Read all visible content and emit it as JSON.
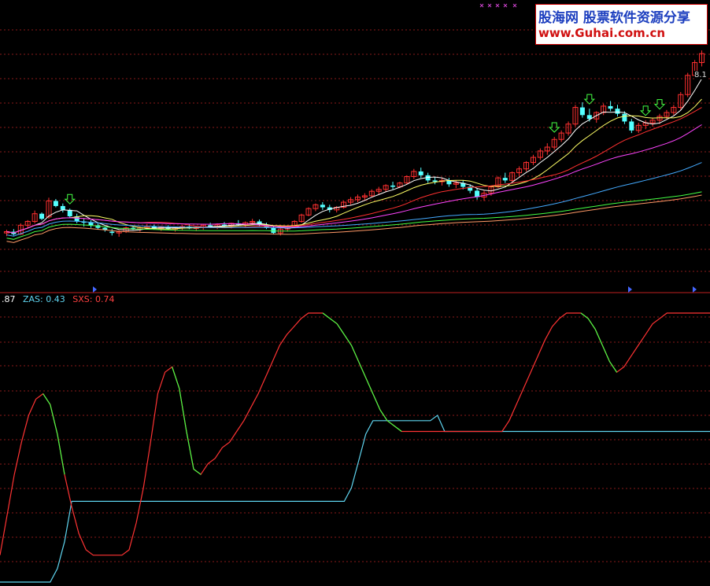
{
  "watermark": {
    "line1": "股海网 股票软件资源分享",
    "line2": "www.Guhai.com.cn"
  },
  "price_tag": "8.1",
  "legend": [
    {
      "text": ".87",
      "color": "#ffffff"
    },
    {
      "text": "ZAS: 0.43",
      "color": "#5fd5f0"
    },
    {
      "text": "SXS: 0.74",
      "color": "#ff4040"
    }
  ],
  "colors": {
    "up": "#ff3030",
    "down": "#54ffff",
    "grid": "#8a1a1a",
    "ma5": "#ffffff",
    "ma10": "#ffff66",
    "ma20": "#ff3030",
    "ma30": "#ff44ff",
    "ma60": "#44aaff",
    "ma120": "#44ff44",
    "ma250": "#ff9966",
    "zas": "#5fd5f0",
    "sxs": "#ff3333",
    "osc_green": "#44ff44"
  },
  "chart_data": [
    {
      "type": "candlestick",
      "title": "",
      "ylim": [
        4.8,
        8.3
      ],
      "candles": [
        [
          5.4,
          5.45,
          5.35,
          5.42
        ],
        [
          5.42,
          5.46,
          5.36,
          5.38
        ],
        [
          5.38,
          5.55,
          5.37,
          5.52
        ],
        [
          5.52,
          5.6,
          5.48,
          5.58
        ],
        [
          5.58,
          5.75,
          5.55,
          5.7
        ],
        [
          5.7,
          5.72,
          5.6,
          5.62
        ],
        [
          5.65,
          5.95,
          5.62,
          5.9
        ],
        [
          5.9,
          5.93,
          5.8,
          5.82
        ],
        [
          5.82,
          5.86,
          5.72,
          5.76
        ],
        [
          5.76,
          5.78,
          5.64,
          5.66
        ],
        [
          5.66,
          5.7,
          5.55,
          5.58
        ],
        [
          5.58,
          5.62,
          5.5,
          5.56
        ],
        [
          5.56,
          5.6,
          5.48,
          5.52
        ],
        [
          5.52,
          5.55,
          5.45,
          5.48
        ],
        [
          5.48,
          5.5,
          5.42,
          5.45
        ],
        [
          5.42,
          5.46,
          5.36,
          5.4
        ],
        [
          5.4,
          5.44,
          5.34,
          5.42
        ],
        [
          5.42,
          5.5,
          5.4,
          5.48
        ],
        [
          5.48,
          5.52,
          5.44,
          5.46
        ],
        [
          5.46,
          5.5,
          5.42,
          5.48
        ],
        [
          5.48,
          5.54,
          5.46,
          5.5
        ],
        [
          5.5,
          5.53,
          5.45,
          5.47
        ],
        [
          5.47,
          5.51,
          5.43,
          5.49
        ],
        [
          5.49,
          5.52,
          5.45,
          5.46
        ],
        [
          5.46,
          5.5,
          5.42,
          5.48
        ],
        [
          5.48,
          5.52,
          5.44,
          5.5
        ],
        [
          5.5,
          5.54,
          5.46,
          5.47
        ],
        [
          5.47,
          5.51,
          5.43,
          5.49
        ],
        [
          5.49,
          5.53,
          5.45,
          5.52
        ],
        [
          5.52,
          5.56,
          5.48,
          5.5
        ],
        [
          5.5,
          5.55,
          5.46,
          5.53
        ],
        [
          5.53,
          5.57,
          5.49,
          5.51
        ],
        [
          5.51,
          5.56,
          5.47,
          5.55
        ],
        [
          5.55,
          5.6,
          5.51,
          5.53
        ],
        [
          5.53,
          5.58,
          5.49,
          5.56
        ],
        [
          5.56,
          5.62,
          5.52,
          5.58
        ],
        [
          5.58,
          5.61,
          5.5,
          5.52
        ],
        [
          5.52,
          5.56,
          5.46,
          5.48
        ],
        [
          5.48,
          5.5,
          5.38,
          5.4
        ],
        [
          5.4,
          5.48,
          5.36,
          5.46
        ],
        [
          5.46,
          5.52,
          5.42,
          5.5
        ],
        [
          5.5,
          5.6,
          5.48,
          5.58
        ],
        [
          5.58,
          5.7,
          5.56,
          5.68
        ],
        [
          5.68,
          5.8,
          5.66,
          5.78
        ],
        [
          5.78,
          5.86,
          5.74,
          5.84
        ],
        [
          5.84,
          5.88,
          5.76,
          5.8
        ],
        [
          5.8,
          5.84,
          5.72,
          5.76
        ],
        [
          5.76,
          5.82,
          5.72,
          5.8
        ],
        [
          5.8,
          5.9,
          5.78,
          5.88
        ],
        [
          5.88,
          5.96,
          5.84,
          5.92
        ],
        [
          5.92,
          6.0,
          5.88,
          5.96
        ],
        [
          5.96,
          6.02,
          5.9,
          5.98
        ],
        [
          5.98,
          6.08,
          5.96,
          6.05
        ],
        [
          6.05,
          6.12,
          6.0,
          6.08
        ],
        [
          6.08,
          6.16,
          6.04,
          6.14
        ],
        [
          6.14,
          6.2,
          6.08,
          6.12
        ],
        [
          6.12,
          6.2,
          6.1,
          6.18
        ],
        [
          6.18,
          6.3,
          6.16,
          6.28
        ],
        [
          6.28,
          6.4,
          6.24,
          6.36
        ],
        [
          6.36,
          6.42,
          6.26,
          6.3
        ],
        [
          6.3,
          6.34,
          6.18,
          6.22
        ],
        [
          6.22,
          6.28,
          6.16,
          6.2
        ],
        [
          6.2,
          6.26,
          6.14,
          6.22
        ],
        [
          6.22,
          6.26,
          6.12,
          6.16
        ],
        [
          6.16,
          6.22,
          6.1,
          6.18
        ],
        [
          6.18,
          6.22,
          6.08,
          6.12
        ],
        [
          6.12,
          6.16,
          6.02,
          6.06
        ],
        [
          6.06,
          6.1,
          5.92,
          5.96
        ],
        [
          5.96,
          6.06,
          5.9,
          6.02
        ],
        [
          6.02,
          6.14,
          5.98,
          6.12
        ],
        [
          6.12,
          6.28,
          6.1,
          6.26
        ],
        [
          6.26,
          6.34,
          6.18,
          6.22
        ],
        [
          6.22,
          6.36,
          6.2,
          6.34
        ],
        [
          6.34,
          6.44,
          6.28,
          6.4
        ],
        [
          6.4,
          6.52,
          6.36,
          6.5
        ],
        [
          6.5,
          6.62,
          6.46,
          6.58
        ],
        [
          6.58,
          6.72,
          6.54,
          6.68
        ],
        [
          6.68,
          6.8,
          6.62,
          6.74
        ],
        [
          6.74,
          6.9,
          6.7,
          6.86
        ],
        [
          6.86,
          7.0,
          6.82,
          6.96
        ],
        [
          6.96,
          7.14,
          6.92,
          7.1
        ],
        [
          7.1,
          7.4,
          7.06,
          7.36
        ],
        [
          7.36,
          7.44,
          7.2,
          7.24
        ],
        [
          7.24,
          7.34,
          7.14,
          7.18
        ],
        [
          7.18,
          7.3,
          7.12,
          7.28
        ],
        [
          7.28,
          7.42,
          7.24,
          7.38
        ],
        [
          7.38,
          7.46,
          7.3,
          7.34
        ],
        [
          7.34,
          7.4,
          7.22,
          7.26
        ],
        [
          7.26,
          7.3,
          7.1,
          7.14
        ],
        [
          7.14,
          7.18,
          6.96,
          7.0
        ],
        [
          7.0,
          7.12,
          6.96,
          7.08
        ],
        [
          7.08,
          7.16,
          7.02,
          7.12
        ],
        [
          7.12,
          7.2,
          7.06,
          7.16
        ],
        [
          7.16,
          7.26,
          7.1,
          7.22
        ],
        [
          7.22,
          7.32,
          7.18,
          7.28
        ],
        [
          7.28,
          7.4,
          7.24,
          7.36
        ],
        [
          7.36,
          7.6,
          7.32,
          7.56
        ],
        [
          7.56,
          7.9,
          7.52,
          7.86
        ],
        [
          7.86,
          8.1,
          7.8,
          8.06
        ],
        [
          8.06,
          8.25,
          8.0,
          8.2
        ]
      ],
      "ma_periods": [
        5,
        10,
        20,
        30,
        60,
        120,
        250
      ],
      "arrows": [
        9,
        78,
        83,
        91,
        93
      ]
    },
    {
      "type": "line",
      "title": "",
      "ylim": [
        0,
        1
      ],
      "series": [
        {
          "name": "ZAS",
          "color": "#5fd5f0",
          "values": [
            0.0,
            0.0,
            0.0,
            0.0,
            0.0,
            0.0,
            0.0,
            0.0,
            0.05,
            0.15,
            0.3,
            0.3,
            0.3,
            0.3,
            0.3,
            0.3,
            0.3,
            0.3,
            0.3,
            0.3,
            0.3,
            0.3,
            0.3,
            0.3,
            0.3,
            0.3,
            0.3,
            0.3,
            0.3,
            0.3,
            0.3,
            0.3,
            0.3,
            0.3,
            0.3,
            0.3,
            0.3,
            0.3,
            0.3,
            0.3,
            0.3,
            0.3,
            0.3,
            0.3,
            0.3,
            0.3,
            0.3,
            0.3,
            0.3,
            0.35,
            0.45,
            0.55,
            0.6,
            0.6,
            0.6,
            0.6,
            0.6,
            0.6,
            0.6,
            0.6,
            0.6,
            0.62,
            0.56,
            0.56,
            0.56,
            0.56,
            0.56,
            0.56,
            0.56,
            0.56,
            0.56,
            0.56,
            0.56,
            0.56,
            0.56,
            0.56,
            0.56,
            0.56,
            0.56,
            0.56,
            0.56,
            0.56,
            0.56,
            0.56,
            0.56,
            0.56,
            0.56,
            0.56,
            0.56,
            0.56,
            0.56,
            0.56,
            0.56,
            0.56,
            0.56,
            0.56,
            0.56,
            0.56,
            0.56,
            0.56
          ]
        },
        {
          "name": "SXS",
          "color": "#ff3333",
          "values": [
            0.1,
            0.25,
            0.4,
            0.52,
            0.62,
            0.68,
            0.7,
            0.66,
            0.55,
            0.4,
            0.28,
            0.18,
            0.12,
            0.1,
            0.1,
            0.1,
            0.1,
            0.1,
            0.12,
            0.22,
            0.35,
            0.52,
            0.7,
            0.78,
            0.8,
            0.72,
            0.56,
            0.42,
            0.4,
            0.44,
            0.46,
            0.5,
            0.52,
            0.56,
            0.6,
            0.65,
            0.7,
            0.76,
            0.82,
            0.88,
            0.92,
            0.95,
            0.98,
            1.0,
            1.0,
            1.0,
            0.98,
            0.96,
            0.92,
            0.88,
            0.82,
            0.76,
            0.7,
            0.64,
            0.6,
            0.58,
            0.56,
            0.56,
            0.56,
            0.56,
            0.56,
            0.56,
            0.56,
            0.56,
            0.56,
            0.56,
            0.56,
            0.56,
            0.56,
            0.56,
            0.56,
            0.6,
            0.66,
            0.72,
            0.78,
            0.84,
            0.9,
            0.95,
            0.98,
            1.0,
            1.0,
            1.0,
            0.98,
            0.94,
            0.88,
            0.82,
            0.78,
            0.8,
            0.84,
            0.88,
            0.92,
            0.96,
            0.98,
            1.0,
            1.0,
            1.0,
            1.0,
            1.0,
            1.0,
            1.0
          ]
        }
      ]
    }
  ]
}
